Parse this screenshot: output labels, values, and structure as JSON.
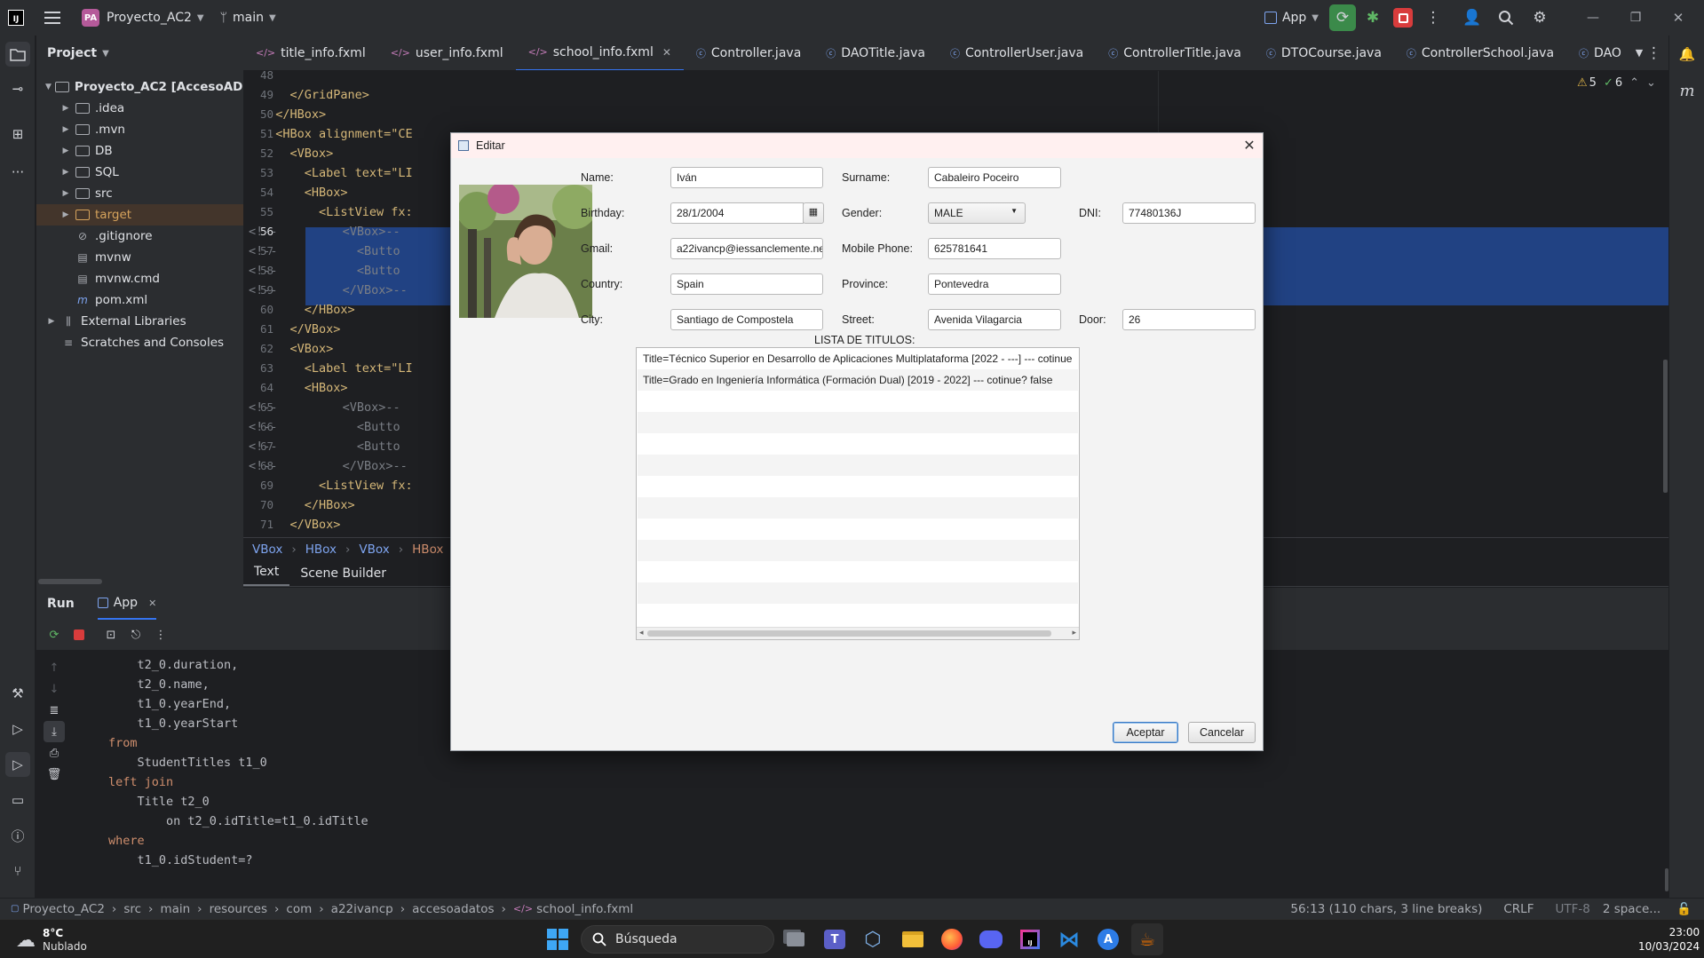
{
  "titlebar": {
    "project_badge": "PA",
    "project_name": "Proyecto_AC2",
    "branch": "main",
    "run_config": "App"
  },
  "project_panel": {
    "title": "Project",
    "root": "Proyecto_AC2 [AccesoADato",
    "items": [
      {
        "label": ".idea"
      },
      {
        "label": ".mvn"
      },
      {
        "label": "DB"
      },
      {
        "label": "SQL"
      },
      {
        "label": "src"
      },
      {
        "label": "target"
      },
      {
        "label": ".gitignore"
      },
      {
        "label": "mvnw"
      },
      {
        "label": "mvnw.cmd"
      },
      {
        "label": "pom.xml"
      }
    ],
    "external_libraries": "External Libraries",
    "scratches": "Scratches and Consoles"
  },
  "tabs": [
    {
      "label": "title_info.fxml"
    },
    {
      "label": "user_info.fxml"
    },
    {
      "label": "school_info.fxml"
    },
    {
      "label": "Controller.java"
    },
    {
      "label": "DAOTitle.java"
    },
    {
      "label": "ControllerUser.java"
    },
    {
      "label": "ControllerTitle.java"
    },
    {
      "label": "DTOCourse.java"
    },
    {
      "label": "ControllerSchool.java"
    },
    {
      "label": "DAO"
    }
  ],
  "editor": {
    "warnings": "5",
    "checks": "6",
    "lines": [
      {
        "n": "48",
        "text": ""
      },
      {
        "n": "49",
        "text": "    </GridPane>"
      },
      {
        "n": "50",
        "text": "  </HBox>"
      },
      {
        "n": "51",
        "text": "  <HBox alignment=\"CE"
      },
      {
        "n": "52",
        "text": "    <VBox>"
      },
      {
        "n": "53",
        "text": "      <Label text=\"LI"
      },
      {
        "n": "54",
        "text": "      <HBox>"
      },
      {
        "n": "55",
        "text": "        <ListView fx:"
      },
      {
        "n": "56",
        "text": "<!--         <VBox>--"
      },
      {
        "n": "57",
        "text": "<!--           <Butto"
      },
      {
        "n": "58",
        "text": "<!--           <Butto"
      },
      {
        "n": "59",
        "text": "<!--         </VBox>--"
      },
      {
        "n": "60",
        "text": "      </HBox>"
      },
      {
        "n": "61",
        "text": "    </VBox>"
      },
      {
        "n": "62",
        "text": "    <VBox>"
      },
      {
        "n": "63",
        "text": "      <Label text=\"LI"
      },
      {
        "n": "64",
        "text": "      <HBox>"
      },
      {
        "n": "65",
        "text": "<!--         <VBox>--"
      },
      {
        "n": "66",
        "text": "<!--           <Butto"
      },
      {
        "n": "67",
        "text": "<!--           <Butto"
      },
      {
        "n": "68",
        "text": "<!--         </VBox>--"
      },
      {
        "n": "69",
        "text": "        <ListView fx:"
      },
      {
        "n": "70",
        "text": "      </HBox>"
      },
      {
        "n": "71",
        "text": "    </VBox>"
      }
    ],
    "breadcrumb": [
      "VBox",
      "HBox",
      "VBox",
      "HBox"
    ],
    "design_tabs": [
      "Text",
      "Scene Builder"
    ]
  },
  "run_panel": {
    "title": "Run",
    "tab": "App",
    "console": [
      "    t2_0.duration,",
      "    t2_0.name,",
      "    t1_0.yearEnd,",
      "    t1_0.yearStart",
      "from",
      "    StudentTitles t1_0",
      "left join",
      "    Title t2_0",
      "        on t2_0.idTitle=t1_0.idTitle",
      "where",
      "    t1_0.idStudent=?"
    ]
  },
  "statusbar": {
    "path": [
      "Proyecto_AC2",
      "src",
      "main",
      "resources",
      "com",
      "a22ivancp",
      "accesoadatos",
      "school_info.fxml"
    ],
    "position": "56:13 (110 chars, 3 line breaks)",
    "line_sep": "CRLF",
    "encoding": "UTF-8",
    "indent": "2 space..."
  },
  "taskbar": {
    "temp": "8°C",
    "weather": "Nublado",
    "search_placeholder": "Búsqueda",
    "time": "23:00",
    "date": "10/03/2024"
  },
  "dialog": {
    "title": "Editar",
    "labels": {
      "name": "Name:",
      "surname": "Surname:",
      "birthday": "Birthday:",
      "gender": "Gender:",
      "dni": "DNI:",
      "gmail": "Gmail:",
      "mobile": "Mobile Phone:",
      "country": "Country:",
      "province": "Province:",
      "city": "City:",
      "street": "Street:",
      "door": "Door:",
      "list": "LISTA DE TITULOS:"
    },
    "values": {
      "name": "Iván",
      "surname": "Cabaleiro Poceiro",
      "birthday": "28/1/2004",
      "gender": "MALE",
      "dni": "77480136J",
      "gmail": "a22ivancp@iessanclemente.ne",
      "mobile": "625781641",
      "country": "Spain",
      "province": "Pontevedra",
      "city": "Santiago de Compostela",
      "street": "Avenida Vilagarcia",
      "door": "26"
    },
    "titles": [
      "Title=Técnico Superior en Desarrollo de Aplicaciones Multiplataforma [2022 - ---] --- cotinue",
      "Title=Grado en Ingeniería Informática (Formación Dual) [2019 - 2022] --- cotinue? false"
    ],
    "accept": "Aceptar",
    "cancel": "Cancelar"
  }
}
